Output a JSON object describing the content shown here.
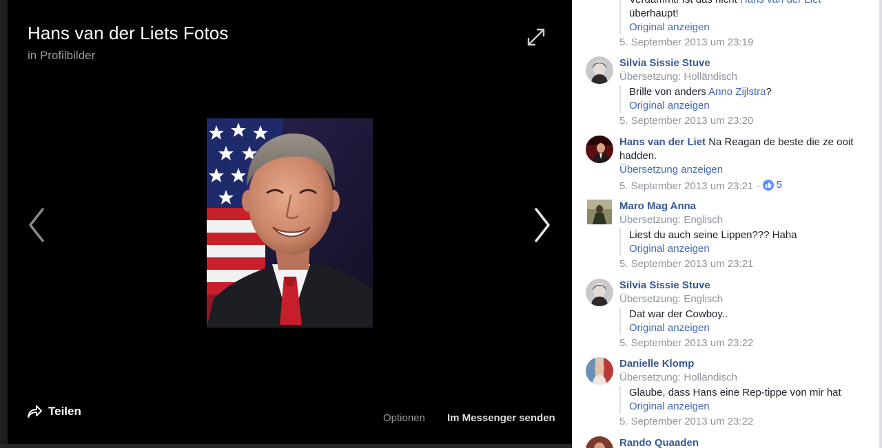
{
  "viewer": {
    "title": "Hans van der Liets Fotos",
    "subtitle": "in Profilbilder",
    "share_label": "Teilen",
    "options_label": "Optionen",
    "messenger_label": "Im Messenger senden"
  },
  "comments": {
    "partial_top": {
      "line1_prefix": "Verdammt! Ist das nicht ",
      "line1_name": "Hans van der Liet",
      "line2": "überhaupt!",
      "original_link": "Original anzeigen",
      "timestamp": "5. September 2013 um 23:19"
    },
    "items": [
      {
        "name": "Silvia Sissie Stuve",
        "translation": "Übersetzung: Holländisch",
        "text_prefix": "Brille von anders ",
        "text_mention": "Anno Zijlstra",
        "text_suffix": "?",
        "original_link": "Original anzeigen",
        "timestamp": "5. September 2013 um 23:20"
      },
      {
        "name": "Hans van der Liet",
        "text": " Na Reagan de beste die ze ooit hadden.",
        "translation_link": "Übersetzung anzeigen",
        "timestamp": "5. September 2013 um 23:21",
        "separator": " · ",
        "like_count": "5"
      },
      {
        "name": "Maro Mag Anna",
        "translation": "Übersetzung: Englisch",
        "text": "Liest du auch seine Lippen??? Haha",
        "original_link": "Original anzeigen",
        "timestamp": "5. September 2013 um 23:21"
      },
      {
        "name": "Silvia Sissie Stuve",
        "translation": "Übersetzung: Englisch",
        "text": "Dat war der Cowboy..",
        "original_link": "Original anzeigen",
        "timestamp": "5. September 2013 um 23:22"
      },
      {
        "name": "Danielle Klomp",
        "translation": "Übersetzung: Holländisch",
        "text": "Glaube, dass Hans eine Rep-tippe von mir hat",
        "original_link": "Original anzeigen",
        "timestamp": "5. September 2013 um 23:22"
      },
      {
        "name": "Rando Quaaden"
      }
    ]
  },
  "icons": {
    "expand": "expand-icon",
    "prev": "chevron-left-icon",
    "next": "chevron-right-icon",
    "share": "share-arrow-icon",
    "like": "thumbs-up-icon"
  },
  "colors": {
    "viewer_bg": "#000000",
    "link_blue": "#4267b2",
    "name_blue": "#365899",
    "meta_gray": "#90949c"
  }
}
